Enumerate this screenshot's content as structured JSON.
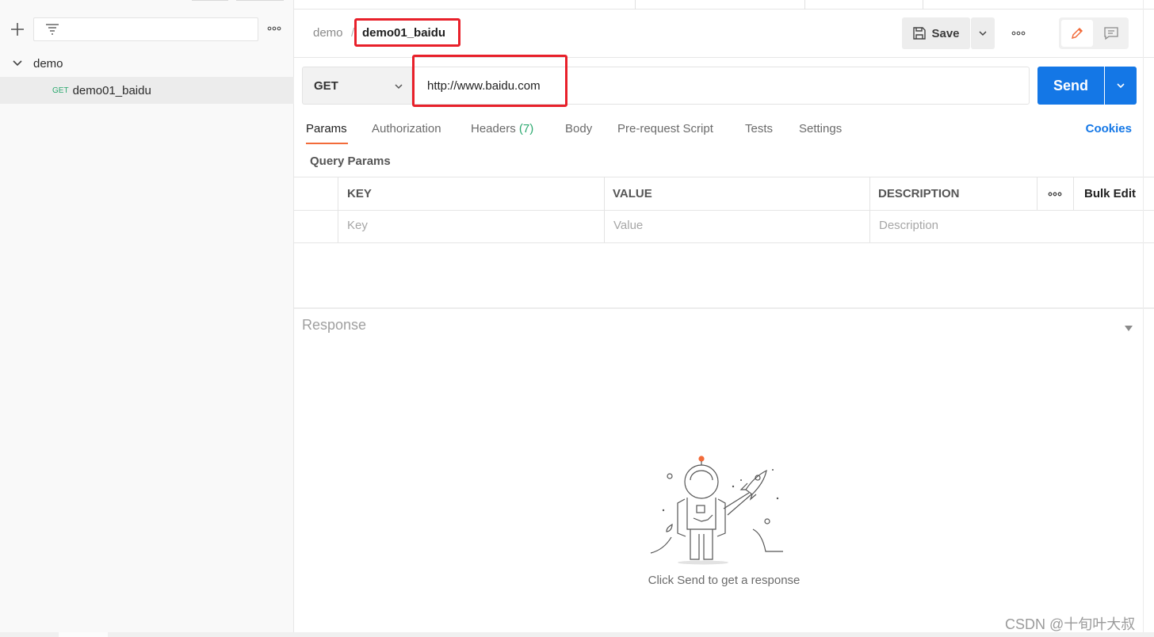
{
  "sidebar": {
    "new_icon": "plus-icon",
    "filter_icon": "filter-icon",
    "more_icon": "more-horizontal-icon",
    "collection": {
      "name": "demo",
      "expanded": true
    },
    "request": {
      "method": "GET",
      "name": "demo01_baidu"
    }
  },
  "header": {
    "breadcrumb_parent": "demo",
    "breadcrumb_separator": "/",
    "request_name": "demo01_baidu",
    "save_label": "Save",
    "more_icon": "more-horizontal-icon"
  },
  "request_bar": {
    "method": "GET",
    "url": "http://www.baidu.com",
    "send_label": "Send"
  },
  "tabs": [
    {
      "label": "Params",
      "active": true
    },
    {
      "label": "Authorization"
    },
    {
      "label": "Headers",
      "count": "(7)"
    },
    {
      "label": "Body"
    },
    {
      "label": "Pre-request Script"
    },
    {
      "label": "Tests"
    },
    {
      "label": "Settings"
    }
  ],
  "cookies_label": "Cookies",
  "query_params": {
    "title": "Query Params",
    "columns": [
      "KEY",
      "VALUE",
      "DESCRIPTION"
    ],
    "bulk_edit": "Bulk Edit",
    "placeholders": {
      "key": "Key",
      "value": "Value",
      "description": "Description"
    }
  },
  "response": {
    "label": "Response",
    "empty_message": "Click Send to get a response"
  },
  "watermark": "CSDN @十旬叶大叔",
  "colors": {
    "accent": "#f26b3a",
    "send": "#1477e6",
    "get_method": "#2aa86e",
    "highlight_box": "#e8202a"
  }
}
